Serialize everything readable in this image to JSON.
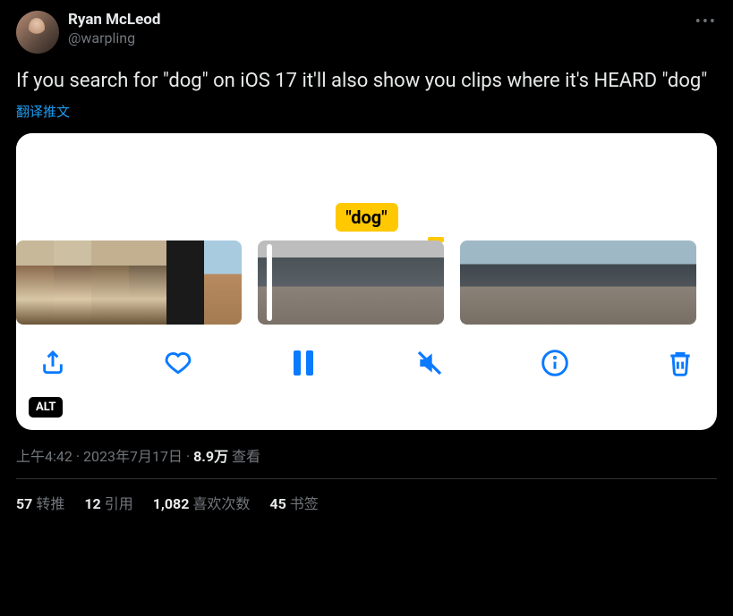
{
  "author": {
    "name": "Ryan McLeod",
    "handle": "@warpling"
  },
  "tweet_text": "If you search for \"dog\" on iOS 17 it'll also show you clips where it's HEARD \"dog\"",
  "translate_label": "翻译推文",
  "media": {
    "caption_label": "\"dog\"",
    "alt_badge": "ALT",
    "toolbar": {
      "share": "share",
      "like": "like",
      "pause": "pause",
      "mute": "mute",
      "info": "info",
      "delete": "delete"
    }
  },
  "meta": {
    "time": "上午4:42",
    "date": "2023年7月17日",
    "views_num": "8.9万",
    "views_label": "查看"
  },
  "stats": {
    "retweets": {
      "num": "57",
      "label": "转推"
    },
    "quotes": {
      "num": "12",
      "label": "引用"
    },
    "likes": {
      "num": "1,082",
      "label": "喜欢次数"
    },
    "bookmarks": {
      "num": "45",
      "label": "书签"
    }
  }
}
